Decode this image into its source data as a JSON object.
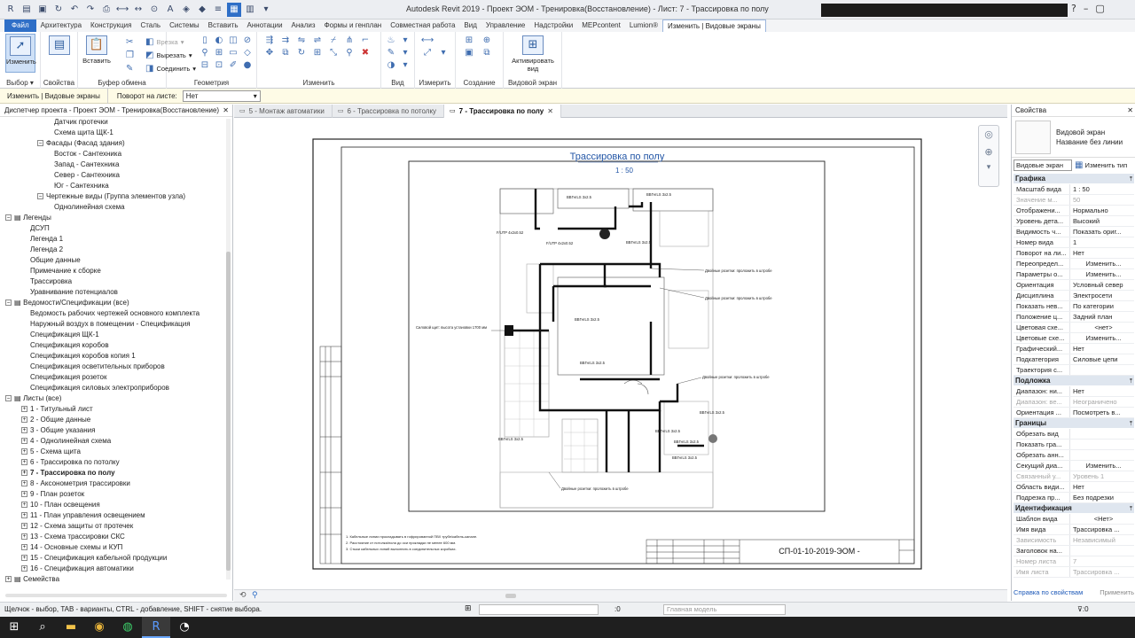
{
  "title": "Autodesk Revit 2019 - Проект ЭОМ - Тренировка(Восстановление) - Лист: 7 - Трассировка по полу",
  "menu": [
    "Файл",
    "Архитектура",
    "Конструкция",
    "Сталь",
    "Системы",
    "Вставить",
    "Аннотации",
    "Анализ",
    "Формы и генплан",
    "Совместная работа",
    "Вид",
    "Управление",
    "Надстройки",
    "MEPcontent",
    "Lumion®",
    "Изменить | Видовые экраны"
  ],
  "ribbon": {
    "modify_label": "Изменить",
    "select_group": "Выбор ▾",
    "properties_group": "Свойства",
    "paste_label": "Вставить",
    "clipboard_group": "Буфер обмена",
    "cut_label": "Вырезать",
    "cope_label": "Врезка",
    "join_label": "Соединить",
    "geometry_group": "Геометрия",
    "modify_group": "Изменить",
    "view_group": "Вид",
    "measure_group": "Измерить",
    "create_group": "Создание",
    "activate_label": "Активировать вид",
    "viewport_group": "Видовой экран"
  },
  "optbar": {
    "context": "Изменить | Видовые экраны",
    "rotation_label": "Поворот на листе:",
    "rotation_value": "Нет"
  },
  "browser": {
    "title": "Диспетчер проекта - Проект ЭОМ - Тренировка(Восстановление)",
    "rows": [
      {
        "t": "Датчик протечки",
        "d": 5,
        "tg": ""
      },
      {
        "t": "Схема щита ЩК-1",
        "d": 5,
        "tg": ""
      },
      {
        "t": "Фасады (Фасад здания)",
        "d": 4,
        "tg": "−"
      },
      {
        "t": "Восток - Сантехника",
        "d": 5,
        "tg": ""
      },
      {
        "t": "Запад - Сантехника",
        "d": 5,
        "tg": ""
      },
      {
        "t": "Север - Сантехника",
        "d": 5,
        "tg": ""
      },
      {
        "t": "Юг - Сантехника",
        "d": 5,
        "tg": ""
      },
      {
        "t": "Чертежные виды (Группа элементов узла)",
        "d": 4,
        "tg": "−"
      },
      {
        "t": "Однолинейная схема",
        "d": 5,
        "tg": ""
      },
      {
        "t": "Легенды",
        "d": 0,
        "tg": "−",
        "ic": true
      },
      {
        "t": "ДСУП",
        "d": 2,
        "tg": ""
      },
      {
        "t": "Легенда 1",
        "d": 2,
        "tg": ""
      },
      {
        "t": "Легенда 2",
        "d": 2,
        "tg": ""
      },
      {
        "t": "Общие данные",
        "d": 2,
        "tg": ""
      },
      {
        "t": "Примечание к сборке",
        "d": 2,
        "tg": ""
      },
      {
        "t": "Трассировка",
        "d": 2,
        "tg": ""
      },
      {
        "t": "Уравнивание потенциалов",
        "d": 2,
        "tg": ""
      },
      {
        "t": "Ведомости/Спецификации (все)",
        "d": 0,
        "tg": "−",
        "ic": true
      },
      {
        "t": "Ведомость рабочих чертежей основного комплекта",
        "d": 2,
        "tg": ""
      },
      {
        "t": "Наружный воздух в помещении - Спецификация",
        "d": 2,
        "tg": ""
      },
      {
        "t": "Спецификация ЩК-1",
        "d": 2,
        "tg": ""
      },
      {
        "t": "Спецификация коробов",
        "d": 2,
        "tg": ""
      },
      {
        "t": "Спецификация коробов копия 1",
        "d": 2,
        "tg": ""
      },
      {
        "t": "Спецификация осветительных приборов",
        "d": 2,
        "tg": ""
      },
      {
        "t": "Спецификация розеток",
        "d": 2,
        "tg": ""
      },
      {
        "t": "Спецификация силовых электроприборов",
        "d": 2,
        "tg": ""
      },
      {
        "t": "Листы (все)",
        "d": 0,
        "tg": "−",
        "ic": true
      },
      {
        "t": "1 - Титульный лист",
        "d": 2,
        "tg": "+"
      },
      {
        "t": "2 - Общие данные",
        "d": 2,
        "tg": "+"
      },
      {
        "t": "3 - Общие указания",
        "d": 2,
        "tg": "+"
      },
      {
        "t": "4 - Однолинейная схема",
        "d": 2,
        "tg": "+"
      },
      {
        "t": "5 - Схема щита",
        "d": 2,
        "tg": "+"
      },
      {
        "t": "6 - Трассировка по потолку",
        "d": 2,
        "tg": "+"
      },
      {
        "t": "7 - Трассировка по полу",
        "d": 2,
        "tg": "+",
        "b": true
      },
      {
        "t": "8 - Аксонометрия трассировки",
        "d": 2,
        "tg": "+"
      },
      {
        "t": "9 - План розеток",
        "d": 2,
        "tg": "+"
      },
      {
        "t": "10 - План освещения",
        "d": 2,
        "tg": "+"
      },
      {
        "t": "11 - План управления освещением",
        "d": 2,
        "tg": "+"
      },
      {
        "t": "12 - Схема защиты от протечек",
        "d": 2,
        "tg": "+"
      },
      {
        "t": "13 - Схема трассировки СКС",
        "d": 2,
        "tg": "+"
      },
      {
        "t": "14 - Основные схемы и КУП",
        "d": 2,
        "tg": "+"
      },
      {
        "t": "15 - Спецификация кабельной продукции",
        "d": 2,
        "tg": "+"
      },
      {
        "t": "16 - Спецификация автоматики",
        "d": 2,
        "tg": "+"
      },
      {
        "t": "Семейства",
        "d": 0,
        "tg": "+",
        "ic": true
      },
      {
        "t": "Группы",
        "d": 0,
        "tg": "+",
        "ic": true
      }
    ]
  },
  "tabs": [
    {
      "label": "5 - Монтаж автоматики",
      "active": false
    },
    {
      "label": "6 - Трассировка по потолку",
      "active": false
    },
    {
      "label": "7 - Трассировка по полу",
      "active": true
    }
  ],
  "sheet": {
    "title": "Трассировка по полу",
    "scale": "1 : 50",
    "stamp": "СП-01-10-2019-ЭОМ -",
    "notes": [
      "1. Кабельные линии прокладывать в гофрированной ПВХ трубе/кабель-канале.",
      "2. Расстояние от потолка/пола до оси прокладки не менее 600 мм.",
      "3. Стыки кабельных линий выполнять в соединительных коробках."
    ],
    "labels": [
      "ВВГнгLS 3х2.5",
      "ВВГнгLS 3х2.5",
      "F/UTP 4х2х0.52",
      "F/UTP 4х2х0.52",
      "ВВГнгLS 3х2.5",
      "ВВГнгLS 3х2.5",
      "ВВГнгLS 3х2.5",
      "ВВГнгLS 3х2.5",
      "ВВГнгLS 3х2.5",
      "ВВГнгLS 3х2.5",
      "ВВГнгLS 3х2.5",
      "ВВГнгLS 3х2.5"
    ],
    "callouts": [
      "Двойные розетки: проложить в штробе",
      "Двойные розетки: проложить в штробе",
      "Силовой щит: высота установки 1700 мм",
      "Двойные розетки: проложить в штробе",
      "Двойные розетки: проложить в штробе"
    ]
  },
  "properties": {
    "title": "Свойства",
    "type_line1": "Видовой экран",
    "type_line2": "Название без линии",
    "instance_dd": "Видовые экран",
    "edit_type": "Изменить тип",
    "sections": [
      {
        "name": "Графика",
        "rows": [
          {
            "k": "Масштаб вида",
            "v": "1 : 50"
          },
          {
            "k": "Значение м...",
            "v": "50",
            "dis": true
          },
          {
            "k": "Отображени...",
            "v": "Нормально"
          },
          {
            "k": "Уровень дета...",
            "v": "Высокий"
          },
          {
            "k": "Видимость ч...",
            "v": "Показать ориг..."
          },
          {
            "k": "Номер вида",
            "v": "1"
          },
          {
            "k": "Поворот на ли...",
            "v": "Нет"
          },
          {
            "k": "Переопредел...",
            "v": "Изменить...",
            "btn": true
          },
          {
            "k": "Параметры о...",
            "v": "Изменить...",
            "btn": true
          },
          {
            "k": "Ориентация",
            "v": "Условный север"
          },
          {
            "k": "Дисциплина",
            "v": "Электросети"
          },
          {
            "k": "Показать нев...",
            "v": "По категории"
          },
          {
            "k": "Положение ц...",
            "v": "Задний план"
          },
          {
            "k": "Цветовая схе...",
            "v": "<нет>",
            "btn": true
          },
          {
            "k": "Цветовые схе...",
            "v": "Изменить...",
            "btn": true
          },
          {
            "k": "Графический...",
            "v": "Нет"
          },
          {
            "k": "Подкатегория",
            "v": "Силовые цепи"
          },
          {
            "k": "Траектория с...",
            "v": ""
          }
        ]
      },
      {
        "name": "Подложка",
        "rows": [
          {
            "k": "Диапазон: ни...",
            "v": "Нет"
          },
          {
            "k": "Диапазон: ве...",
            "v": "Неограничено",
            "dis": true
          },
          {
            "k": "Ориентация ...",
            "v": "Посмотреть в..."
          }
        ]
      },
      {
        "name": "Границы",
        "rows": [
          {
            "k": "Обрезать вид",
            "v": ""
          },
          {
            "k": "Показать гра...",
            "v": ""
          },
          {
            "k": "Обрезать анн...",
            "v": ""
          },
          {
            "k": "Секущий диа...",
            "v": "Изменить...",
            "btn": true
          },
          {
            "k": "Связанный у...",
            "v": "Уровень 1",
            "dis": true
          },
          {
            "k": "Область види...",
            "v": "Нет"
          },
          {
            "k": "Подрезка пр...",
            "v": "Без подрезки"
          }
        ]
      },
      {
        "name": "Идентификация",
        "rows": [
          {
            "k": "Шаблон вида",
            "v": "<Нет>",
            "btn": true
          },
          {
            "k": "Имя вида",
            "v": "Трассировка ..."
          },
          {
            "k": "Зависимость",
            "v": "Независимый",
            "dis": true
          },
          {
            "k": "Заголовок на...",
            "v": ""
          },
          {
            "k": "Номер листа",
            "v": "7",
            "dis": true
          },
          {
            "k": "Имя листа",
            "v": "Трассировка ...",
            "dis": true
          }
        ]
      }
    ],
    "help_link": "Справка по свойствам",
    "apply": "Применить"
  },
  "status": {
    "message": "Щелчок - выбор, TAB - варианты, CTRL - добавление, SHIFT - снятие выбора.",
    "zero": ":0",
    "model": "Главная модель"
  }
}
